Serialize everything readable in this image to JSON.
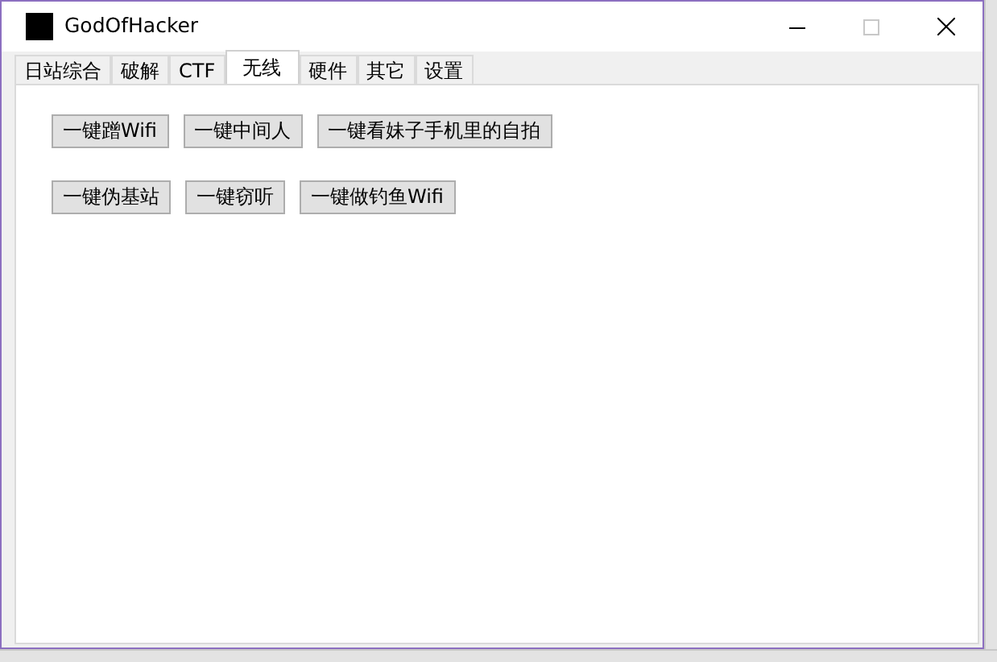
{
  "window": {
    "title": "GodOfHacker",
    "maximize_disabled": true
  },
  "tabs": [
    {
      "label": "日站综合",
      "selected": false
    },
    {
      "label": "破解",
      "selected": false
    },
    {
      "label": "CTF",
      "selected": false
    },
    {
      "label": "无线",
      "selected": true
    },
    {
      "label": "硬件",
      "selected": false
    },
    {
      "label": "其它",
      "selected": false
    },
    {
      "label": "设置",
      "selected": false
    }
  ],
  "button_rows": [
    {
      "buttons": [
        "一键蹭Wifi",
        "一键中间人",
        "一键看妹子手机里的自拍"
      ]
    },
    {
      "buttons": [
        "一键伪基站",
        "一键窃听",
        "一键做钓鱼Wifi"
      ]
    }
  ]
}
